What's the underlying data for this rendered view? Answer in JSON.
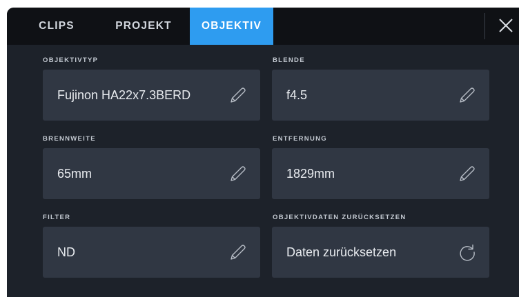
{
  "tabs": [
    {
      "label": "CLIPS",
      "active": false
    },
    {
      "label": "PROJEKT",
      "active": false
    },
    {
      "label": "OBJEKTIV",
      "active": true
    }
  ],
  "fields": {
    "lens_type": {
      "label": "OBJEKTIVTYP",
      "value": "Fujinon HA22x7.3BERD",
      "icon": "pencil-icon"
    },
    "aperture": {
      "label": "BLENDE",
      "value": "f4.5",
      "icon": "pencil-icon"
    },
    "focal_length": {
      "label": "BRENNWEITE",
      "value": "65mm",
      "icon": "pencil-icon"
    },
    "distance": {
      "label": "ENTFERNUNG",
      "value": "1829mm",
      "icon": "pencil-icon"
    },
    "filter": {
      "label": "FILTER",
      "value": "ND",
      "icon": "pencil-icon"
    },
    "reset": {
      "label": "OBJEKTIVDATEN ZURÜCKSETZEN",
      "value": "Daten zurücksetzen",
      "icon": "refresh-icon"
    }
  },
  "colors": {
    "background": "#1d222a",
    "tabbar": "#0f1115",
    "active_tab": "#2e9cf0",
    "field_box": "#303743"
  }
}
